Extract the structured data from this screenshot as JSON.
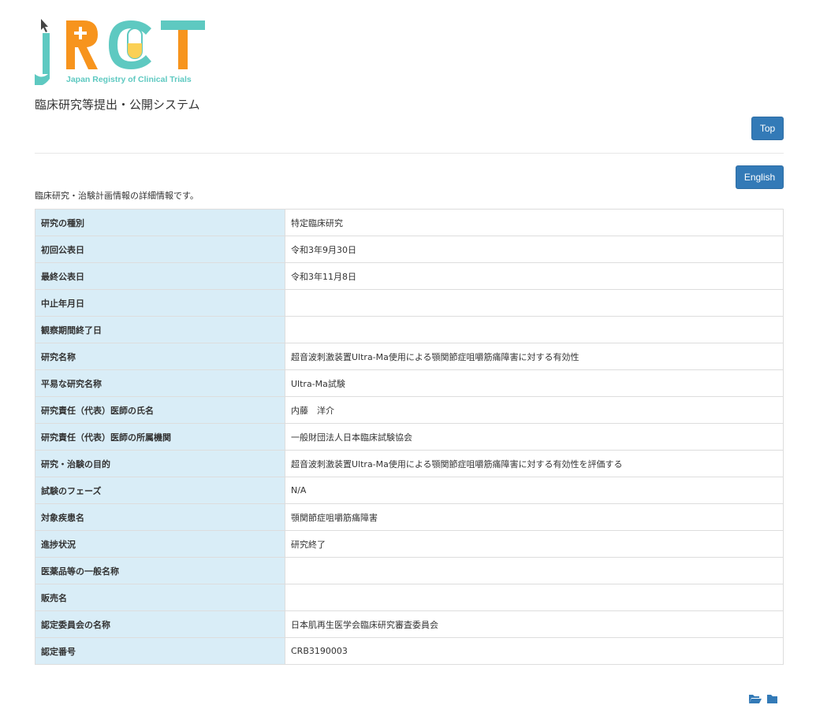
{
  "logo": {
    "letters": "jRCT",
    "tagline": "Japan Registry of Clinical Trials"
  },
  "header": {
    "system_title": "臨床研究等提出・公開システム",
    "top_button": "Top",
    "english_button": "English"
  },
  "intro_text": "臨床研究・治験計画情報の詳細情報です。",
  "rows": [
    {
      "label": "研究の種別",
      "value": "特定臨床研究"
    },
    {
      "label": "初回公表日",
      "value": "令和3年9月30日"
    },
    {
      "label": "最終公表日",
      "value": "令和3年11月8日"
    },
    {
      "label": "中止年月日",
      "value": ""
    },
    {
      "label": "観察期間終了日",
      "value": ""
    },
    {
      "label": "研究名称",
      "value": "超音波刺激装置Ultra-Ma使用による顎関節症咀嚼筋痛障害に対する有効性"
    },
    {
      "label": "平易な研究名称",
      "value": "Ultra-Ma試験"
    },
    {
      "label": "研究責任（代表）医師の氏名",
      "value": "内藤　洋介"
    },
    {
      "label": "研究責任（代表）医師の所属機関",
      "value": "一般財団法人日本臨床試験協会"
    },
    {
      "label": "研究・治験の目的",
      "value": "超音波刺激装置Ultra-Ma使用による顎関節症咀嚼筋痛障害に対する有効性を評価する"
    },
    {
      "label": "試験のフェーズ",
      "value": "N/A"
    },
    {
      "label": "対象疾患名",
      "value": "顎関節症咀嚼筋痛障害"
    },
    {
      "label": "進捗状況",
      "value": "研究終了"
    },
    {
      "label": "医薬品等の一般名称",
      "value": ""
    },
    {
      "label": "販売名",
      "value": ""
    },
    {
      "label": "認定委員会の名称",
      "value": "日本肌再生医学会臨床研究審査委員会"
    },
    {
      "label": "認定番号",
      "value": "CRB3190003"
    }
  ],
  "footer": {
    "icons": [
      "folder-open-icon",
      "folder-icon"
    ]
  },
  "colors": {
    "teal": "#5ec9c1",
    "orange": "#f7941d",
    "button_blue": "#337ab7",
    "label_bg": "#d9edf7"
  }
}
